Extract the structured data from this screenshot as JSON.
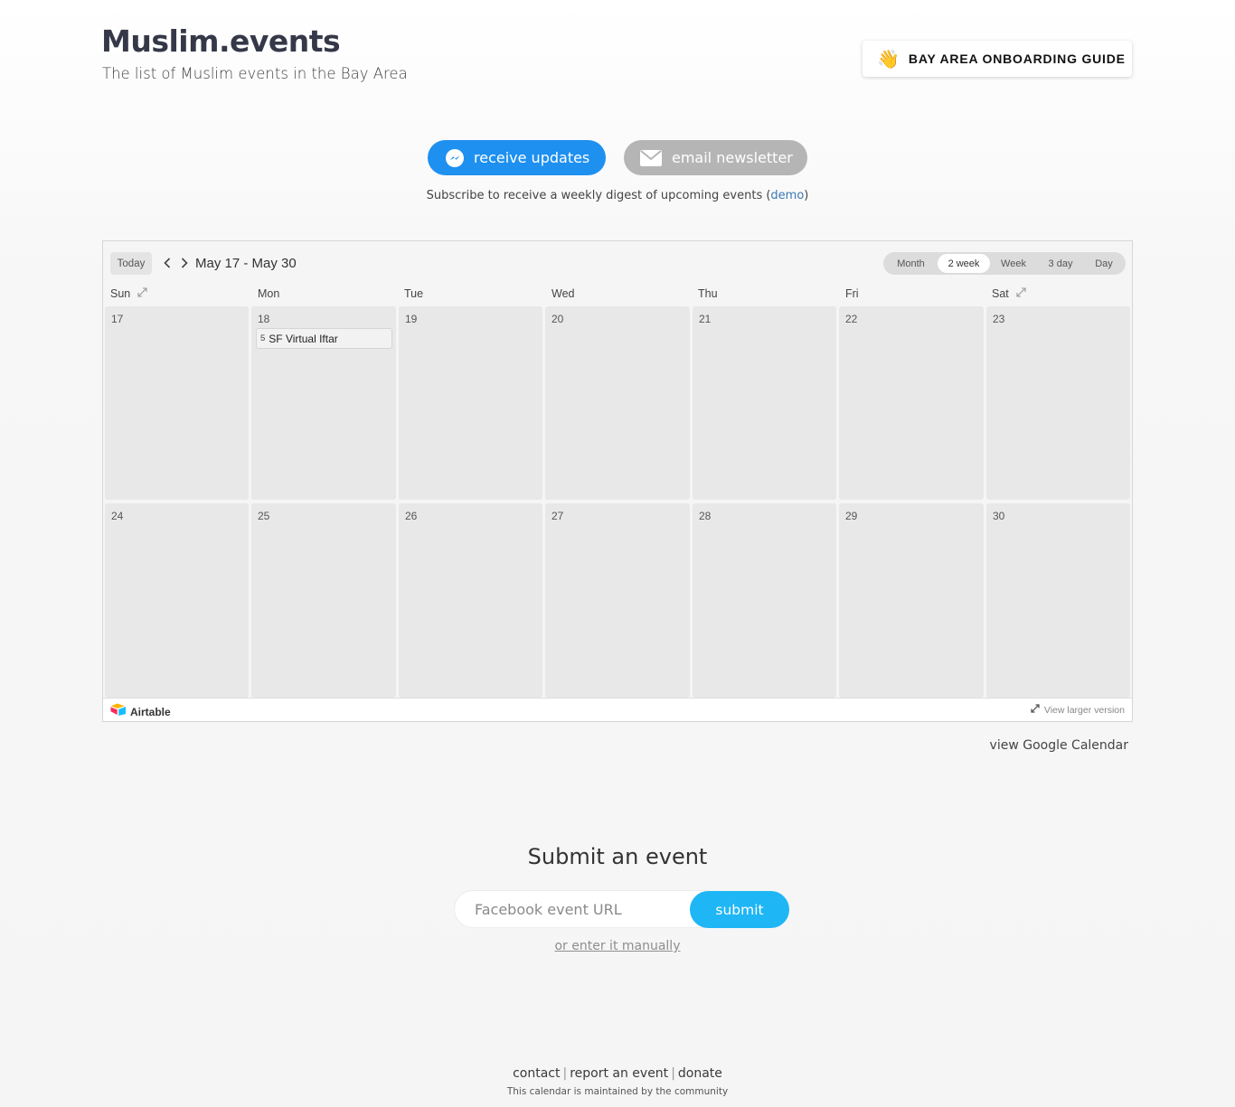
{
  "header": {
    "logo": "Muslim.events",
    "tagline": "The list of Muslim events in the Bay Area",
    "guide_button": "BAY AREA ONBOARDING GUIDE",
    "guide_icon": "waving-hand-icon"
  },
  "subscribe": {
    "messenger_label": "receive updates",
    "newsletter_label": "email newsletter",
    "note_text": "Subscribe to receive a weekly digest of upcoming events (",
    "note_link": "demo",
    "note_close": ")"
  },
  "calendar": {
    "today_label": "Today",
    "range": "May 17 - May 30",
    "views": [
      "Month",
      "2 week",
      "Week",
      "3 day",
      "Day"
    ],
    "active_view": "2 week",
    "weekdays": [
      "Sun",
      "Mon",
      "Tue",
      "Wed",
      "Thu",
      "Fri",
      "Sat"
    ],
    "weeks": [
      [
        "17",
        "18",
        "19",
        "20",
        "21",
        "22",
        "23"
      ],
      [
        "24",
        "25",
        "26",
        "27",
        "28",
        "29",
        "30"
      ]
    ],
    "event": {
      "day": "18",
      "time": "5",
      "title": "SF Virtual Iftar"
    },
    "brand": "Airtable",
    "larger_version": "View larger version"
  },
  "gcal_link": "view Google Calendar",
  "submit": {
    "title": "Submit an event",
    "placeholder": "Facebook event URL",
    "button": "submit",
    "manual_link": "or enter it manually"
  },
  "footer": {
    "links": [
      "contact",
      "report an event",
      "donate"
    ],
    "separator": "|",
    "note": "This calendar is maintained by the community"
  },
  "colors": {
    "messenger_blue": "#1e90f0",
    "newsletter_gray": "#b5b5b5",
    "submit_blue": "#1eb6f5",
    "logo_navy": "#353848"
  }
}
